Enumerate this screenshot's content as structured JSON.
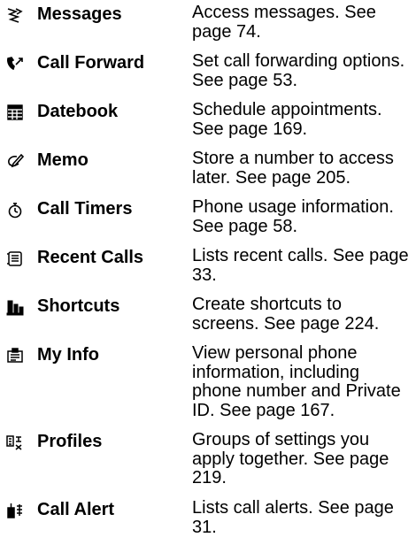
{
  "menu": {
    "items": [
      {
        "icon": "messages-icon",
        "label": "Messages",
        "description": "Access messages. See page 74."
      },
      {
        "icon": "call-forward-icon",
        "label": "Call Forward",
        "description": "Set call forwarding options. See page 53."
      },
      {
        "icon": "datebook-icon",
        "label": "Datebook",
        "description": "Schedule appointments. See page 169."
      },
      {
        "icon": "memo-icon",
        "label": "Memo",
        "description": "Store a number to access later. See page 205."
      },
      {
        "icon": "call-timers-icon",
        "label": "Call Timers",
        "description": "Phone usage information. See page 58."
      },
      {
        "icon": "recent-calls-icon",
        "label": "Recent Calls",
        "description": "Lists recent calls. See page 33."
      },
      {
        "icon": "shortcuts-icon",
        "label": "Shortcuts",
        "description": "Create shortcuts to screens. See page 224."
      },
      {
        "icon": "my-info-icon",
        "label": "My Info",
        "description": "View personal phone information, including phone number and Private ID. See page 167."
      },
      {
        "icon": "profiles-icon",
        "label": "Profiles",
        "description": "Groups of settings you apply together. See page 219."
      },
      {
        "icon": "call-alert-icon",
        "label": "Call Alert",
        "description": "Lists call alerts. See page 31."
      }
    ]
  }
}
